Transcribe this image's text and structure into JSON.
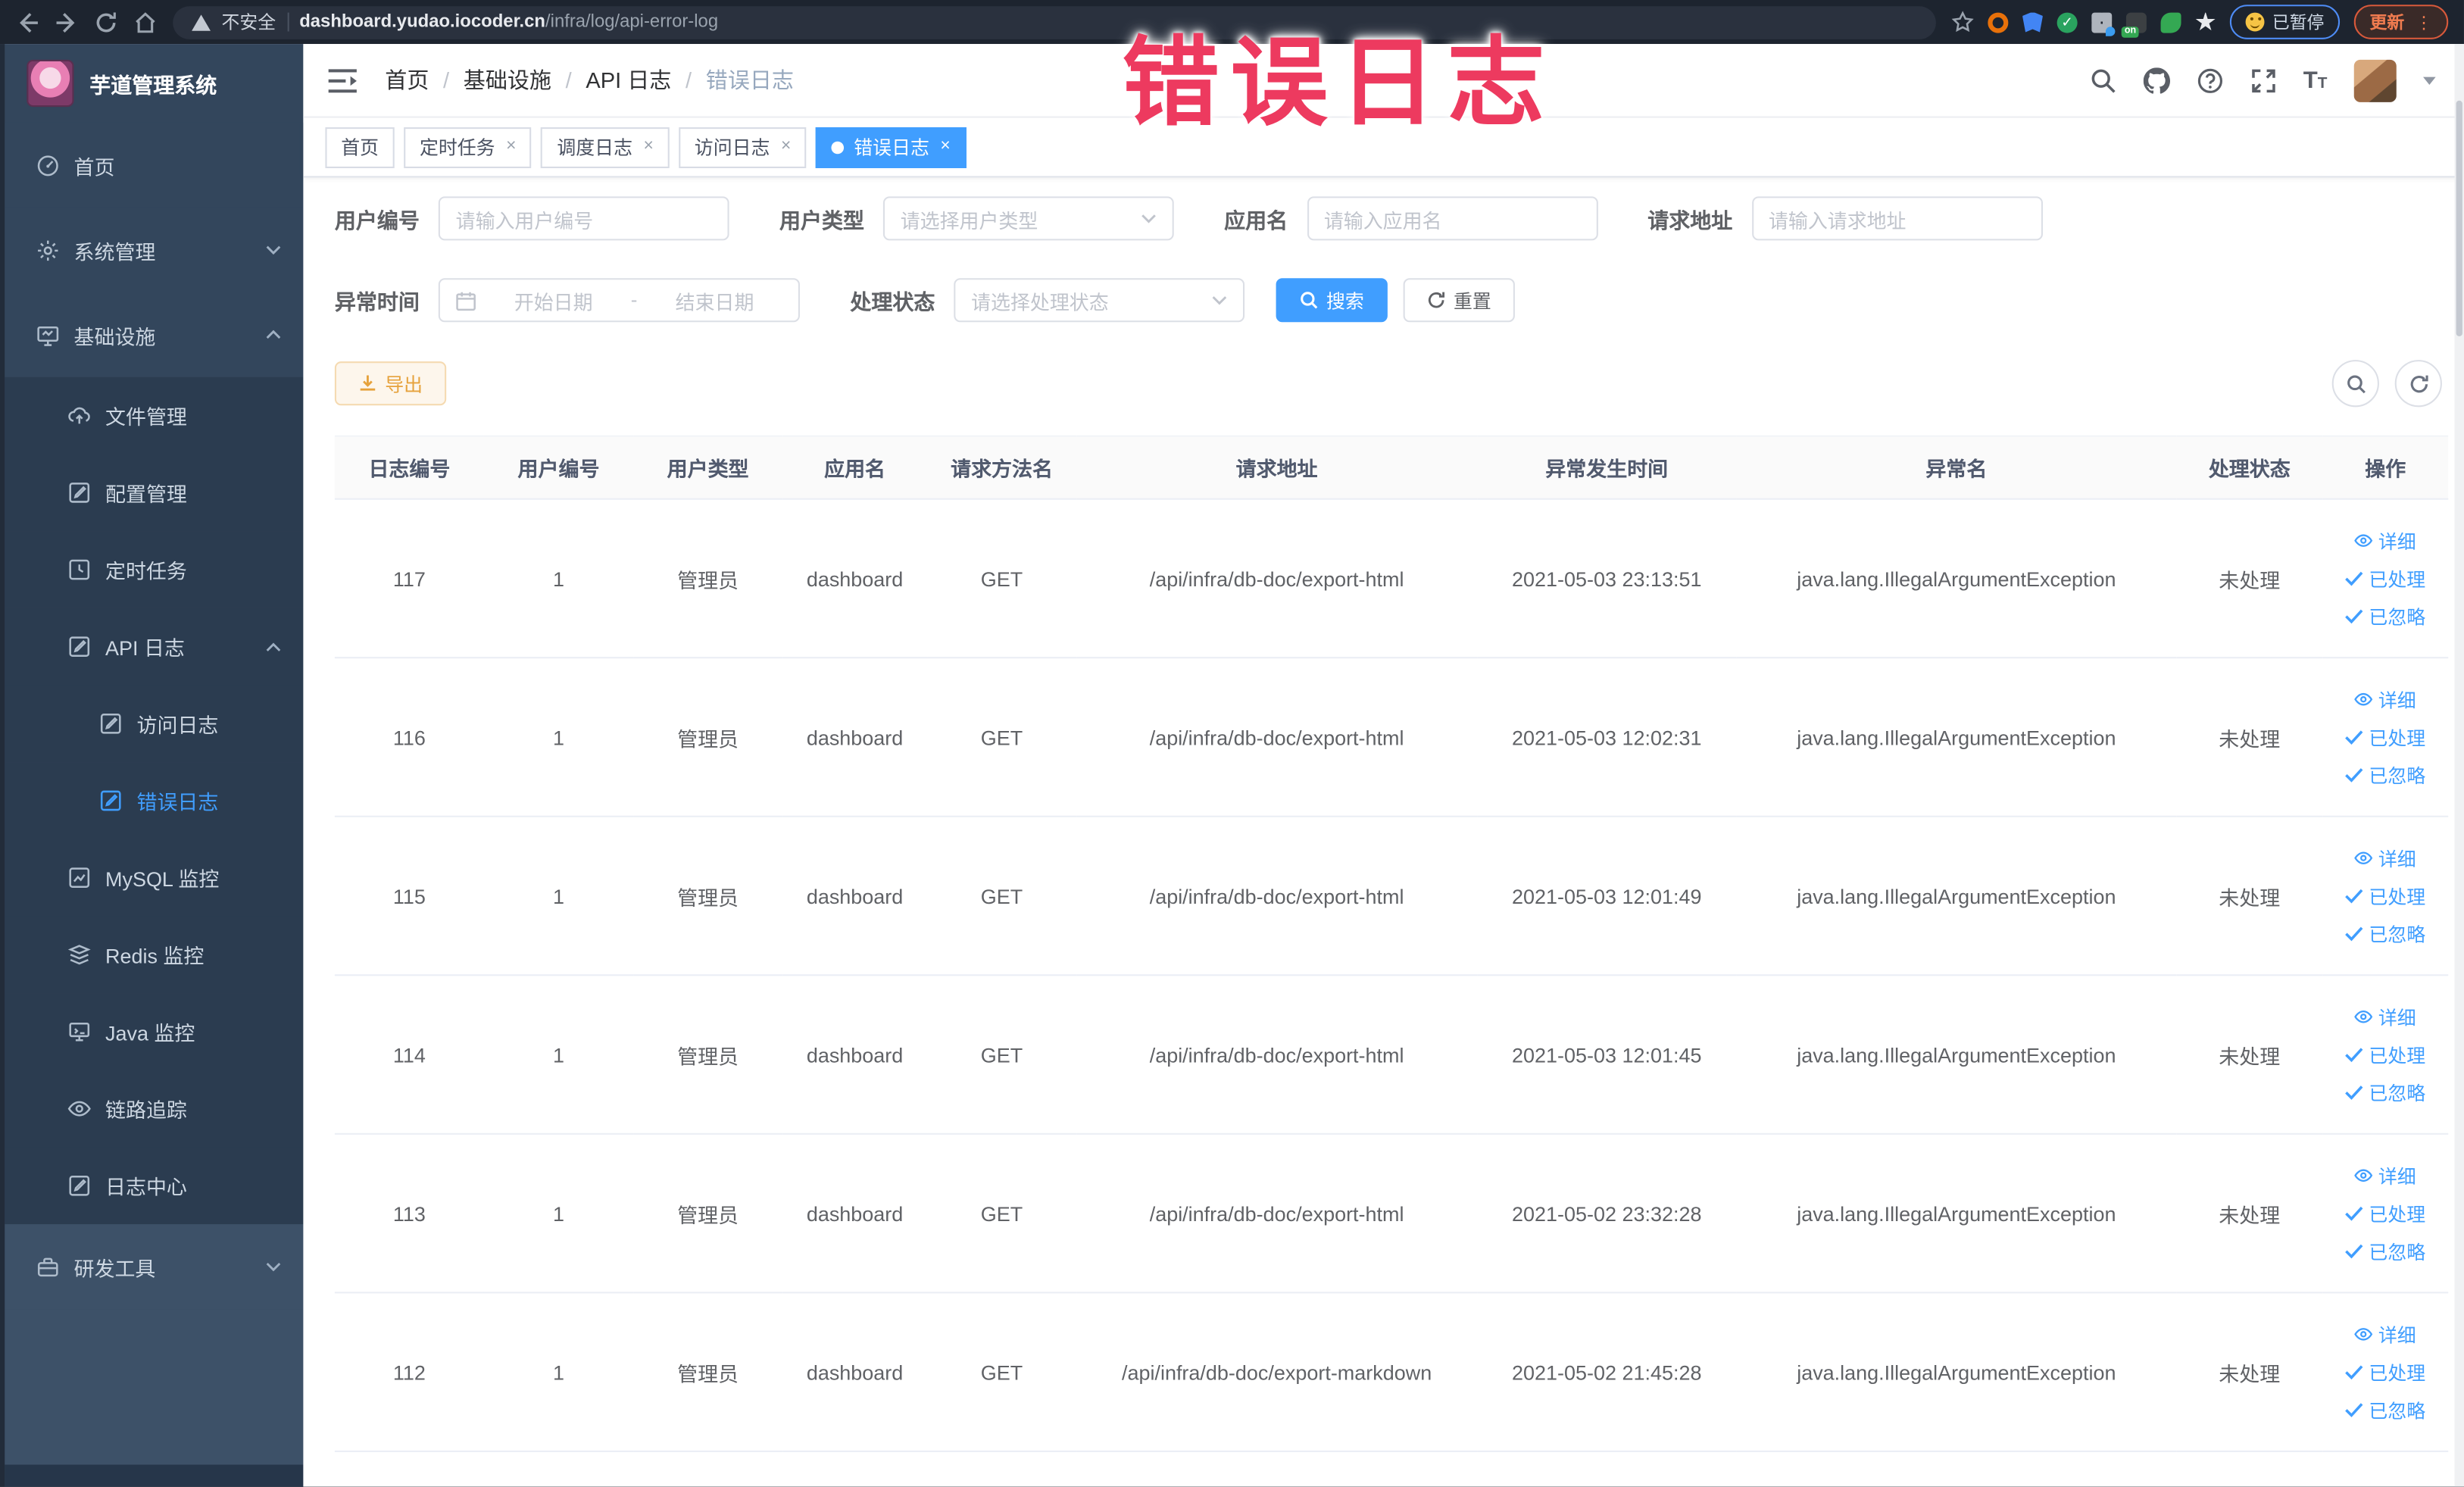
{
  "annotation": {
    "text": "错误日志",
    "color": "#ed3a5f"
  },
  "browser": {
    "security_label": "不安全",
    "url_domain": "dashboard.yudao.iocoder.cn",
    "url_path": "/infra/log/api-error-log",
    "paused_badge_label": "已暂停",
    "update_button_label": "更新",
    "extensions": [
      {
        "name": "extension-orange-ring"
      },
      {
        "name": "extension-blue-shield"
      },
      {
        "name": "extension-green-check",
        "glyph": "✓"
      },
      {
        "name": "extension-grid-blue-drop"
      },
      {
        "name": "extension-dark-on-badge",
        "badge": "on"
      },
      {
        "name": "extension-green-leaf"
      },
      {
        "name": "extension-white-puzzle"
      }
    ]
  },
  "sidebar": {
    "title": "芋道管理系统",
    "menu": [
      {
        "label": "首页",
        "icon": "home-icon",
        "level": 1
      },
      {
        "label": "系统管理",
        "icon": "gear-icon",
        "level": 1,
        "arrow": "down"
      },
      {
        "label": "基础设施",
        "icon": "infrastructure-icon",
        "level": 1,
        "arrow": "up"
      },
      {
        "label": "文件管理",
        "icon": "file-manage-icon",
        "level": 2
      },
      {
        "label": "配置管理",
        "icon": "config-manage-icon",
        "level": 2
      },
      {
        "label": "定时任务",
        "icon": "scheduled-job-icon",
        "level": 2
      },
      {
        "label": "API 日志",
        "icon": "api-log-icon",
        "level": 2,
        "arrow": "up"
      },
      {
        "label": "访问日志",
        "icon": "access-log-icon",
        "level": 3
      },
      {
        "label": "错误日志",
        "icon": "error-log-icon",
        "level": 3,
        "active": true
      },
      {
        "label": "MySQL 监控",
        "icon": "mysql-monitor-icon",
        "level": 2
      },
      {
        "label": "Redis 监控",
        "icon": "redis-monitor-icon",
        "level": 2
      },
      {
        "label": "Java 监控",
        "icon": "java-monitor-icon",
        "level": 2
      },
      {
        "label": "链路追踪",
        "icon": "trace-icon",
        "level": 2
      },
      {
        "label": "日志中心",
        "icon": "log-center-icon",
        "level": 2
      },
      {
        "label": "研发工具",
        "icon": "devtools-icon",
        "level": 1,
        "arrow": "down",
        "section": "light"
      }
    ]
  },
  "header": {
    "breadcrumb": [
      "首页",
      "基础设施",
      "API 日志",
      "错误日志"
    ]
  },
  "tabs": [
    {
      "label": "首页",
      "closable": false,
      "active": false
    },
    {
      "label": "定时任务",
      "closable": true,
      "active": false
    },
    {
      "label": "调度日志",
      "closable": true,
      "active": false
    },
    {
      "label": "访问日志",
      "closable": true,
      "active": false
    },
    {
      "label": "错误日志",
      "closable": true,
      "active": true
    }
  ],
  "filters": {
    "user_id": {
      "label": "用户编号",
      "placeholder": "请输入用户编号"
    },
    "user_type": {
      "label": "用户类型",
      "placeholder": "请选择用户类型"
    },
    "app_name": {
      "label": "应用名",
      "placeholder": "请输入应用名"
    },
    "request_url": {
      "label": "请求地址",
      "placeholder": "请输入请求地址"
    },
    "exception_time": {
      "label": "异常时间",
      "start_placeholder": "开始日期",
      "separator": "-",
      "end_placeholder": "结束日期"
    },
    "process_status": {
      "label": "处理状态",
      "placeholder": "请选择处理状态"
    },
    "search_button": "搜索",
    "reset_button": "重置"
  },
  "toolbar": {
    "export_label": "导出"
  },
  "table": {
    "headers": [
      "日志编号",
      "用户编号",
      "用户类型",
      "应用名",
      "请求方法名",
      "请求地址",
      "异常发生时间",
      "异常名",
      "处理状态",
      "操作"
    ],
    "actions": [
      "详细",
      "已处理",
      "已忽略"
    ],
    "rows": [
      {
        "id": "117",
        "user_id": "1",
        "user_type": "管理员",
        "app": "dashboard",
        "method": "GET",
        "url": "/api/infra/db-doc/export-html",
        "time": "2021-05-03 23:13:51",
        "exception": "java.lang.IllegalArgumentException",
        "status": "未处理"
      },
      {
        "id": "116",
        "user_id": "1",
        "user_type": "管理员",
        "app": "dashboard",
        "method": "GET",
        "url": "/api/infra/db-doc/export-html",
        "time": "2021-05-03 12:02:31",
        "exception": "java.lang.IllegalArgumentException",
        "status": "未处理"
      },
      {
        "id": "115",
        "user_id": "1",
        "user_type": "管理员",
        "app": "dashboard",
        "method": "GET",
        "url": "/api/infra/db-doc/export-html",
        "time": "2021-05-03 12:01:49",
        "exception": "java.lang.IllegalArgumentException",
        "status": "未处理"
      },
      {
        "id": "114",
        "user_id": "1",
        "user_type": "管理员",
        "app": "dashboard",
        "method": "GET",
        "url": "/api/infra/db-doc/export-html",
        "time": "2021-05-03 12:01:45",
        "exception": "java.lang.IllegalArgumentException",
        "status": "未处理"
      },
      {
        "id": "113",
        "user_id": "1",
        "user_type": "管理员",
        "app": "dashboard",
        "method": "GET",
        "url": "/api/infra/db-doc/export-html",
        "time": "2021-05-02 23:32:28",
        "exception": "java.lang.IllegalArgumentException",
        "status": "未处理"
      },
      {
        "id": "112",
        "user_id": "1",
        "user_type": "管理员",
        "app": "dashboard",
        "method": "GET",
        "url": "/api/infra/db-doc/export-markdown",
        "time": "2021-05-02 21:45:28",
        "exception": "java.lang.IllegalArgumentException",
        "status": "未处理"
      }
    ]
  },
  "colors": {
    "accent": "#409eff",
    "warning": "#e6a23c",
    "sidebar_bg": "#33465c",
    "submenu_bg": "#2b3c50",
    "annotation": "#ed3a5f"
  }
}
